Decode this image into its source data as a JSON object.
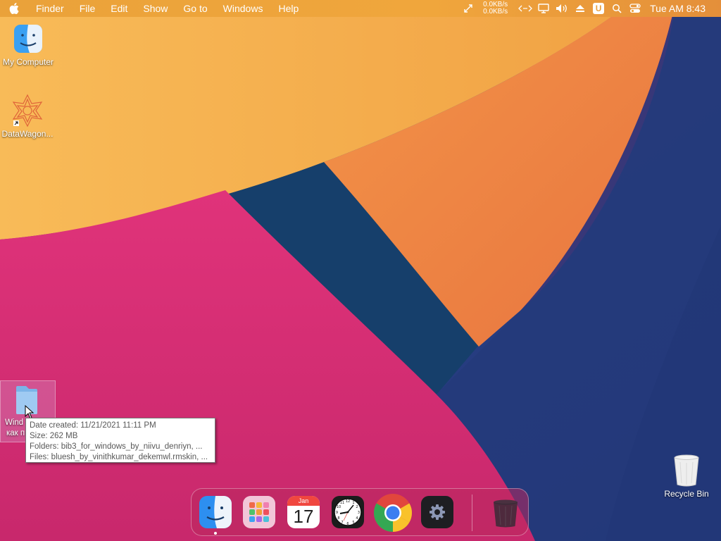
{
  "menubar": {
    "app_name": "Finder",
    "items": [
      "File",
      "Edit",
      "Show",
      "Go to",
      "Windows",
      "Help"
    ],
    "net_up": "0.0KB/s",
    "net_down": "0.0KB/s",
    "u_badge": "U",
    "clock": "Tue AM 8:43"
  },
  "desktop": {
    "icons": [
      {
        "label": "My Computer",
        "icon": "finder-icon"
      },
      {
        "label": "DataWagon...",
        "icon": "datawagon-icon"
      },
      {
        "label_line1": "Wind",
        "label_line2": "как п",
        "icon": "folder-icon"
      },
      {
        "label": "Recycle Bin",
        "icon": "recycle-bin-icon"
      }
    ]
  },
  "tooltip": {
    "date_created": "Date created: 11/21/2021 11:11 PM",
    "size": "Size: 262 MB",
    "folders": "Folders: bib3_for_windows_by_niivu_denriyn, ...",
    "files": "Files: bluesh_by_vinithkumar_dekemwl.rmskin, ..."
  },
  "dock": {
    "apps": [
      {
        "name": "Finder",
        "icon": "finder-icon",
        "running": true
      },
      {
        "name": "Launchpad",
        "icon": "launchpad-icon",
        "running": false
      },
      {
        "name": "Calendar",
        "icon": "calendar-icon",
        "running": false,
        "month": "Jan",
        "day": "17"
      },
      {
        "name": "Clock",
        "icon": "clock-icon",
        "running": false
      },
      {
        "name": "Chrome",
        "icon": "chrome-icon",
        "running": false
      },
      {
        "name": "System Preferences",
        "icon": "gear-icon",
        "running": false
      },
      {
        "name": "Trash",
        "icon": "trash-icon",
        "running": false
      }
    ]
  },
  "colors": {
    "menubar": "#eea33c",
    "wallpaper_pink": "#d8306f",
    "wallpaper_navy": "#1f3d6e",
    "wallpaper_orange": "#f0874a",
    "wallpaper_yellow": "#f6b250"
  }
}
